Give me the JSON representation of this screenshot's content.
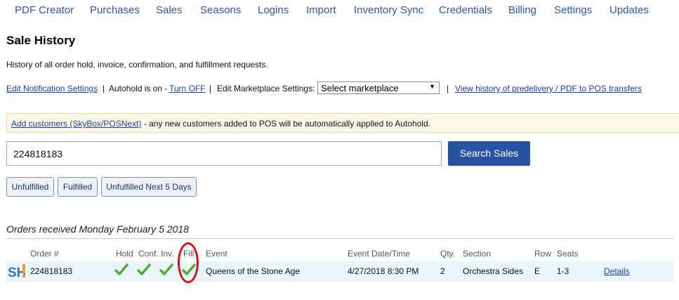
{
  "nav": [
    "PDF Creator",
    "Purchases",
    "Sales",
    "Seasons",
    "Logins",
    "Import",
    "Inventory Sync",
    "Credentials",
    "Billing",
    "Settings",
    "Updates"
  ],
  "page": {
    "title": "Sale History",
    "description": "History of all order hold, invoice, confirmation, and fulfillment requests."
  },
  "settings": {
    "edit_notification": "Edit Notification Settings",
    "sep1": "|",
    "autohold_text": "Autohold is on -",
    "turn_off": "Turn OFF",
    "sep2": "|",
    "marketplace_label": "Edit Marketplace Settings:",
    "marketplace_select": "Select marketplace",
    "sep3": "|",
    "view_history": "View history of predelivery / PDF to POS transfers"
  },
  "banner": {
    "link": "Add customers (SkyBox/POSNext)",
    "text": "- any new customers added to POS will be automatically applied to Autohold."
  },
  "search": {
    "value": "224818183",
    "button": "Search Sales"
  },
  "filters": [
    "Unfulfilled",
    "Fulfilled",
    "Unfulfilled Next 5 Days"
  ],
  "orders": {
    "heading": "Orders received Monday February 5 2018",
    "columns": [
      "Order #",
      "Hold",
      "Conf.",
      "Inv.",
      "Fill",
      "Event",
      "Event Date/Time",
      "Qty.",
      "Section",
      "Row",
      "Seats"
    ],
    "rows": [
      {
        "marketplace_logo": "SH!",
        "order": "224818183",
        "hold": true,
        "conf": true,
        "inv": true,
        "fill": true,
        "event": "Queens of the Stone Age",
        "datetime": "4/27/2018 8:30 PM",
        "qty": "2",
        "section": "Orchestra Sides",
        "row": "E",
        "seats": "1-3",
        "details": "Details"
      }
    ]
  },
  "colors": {
    "link": "#1a3ea8",
    "nav": "#2a5aa5",
    "check": "#4caf2a",
    "highlight": "#dc0f14",
    "search_button": "#2852a4"
  },
  "icons": {
    "status": "checkmark-icon",
    "logo": "stubhub-logo-icon"
  }
}
